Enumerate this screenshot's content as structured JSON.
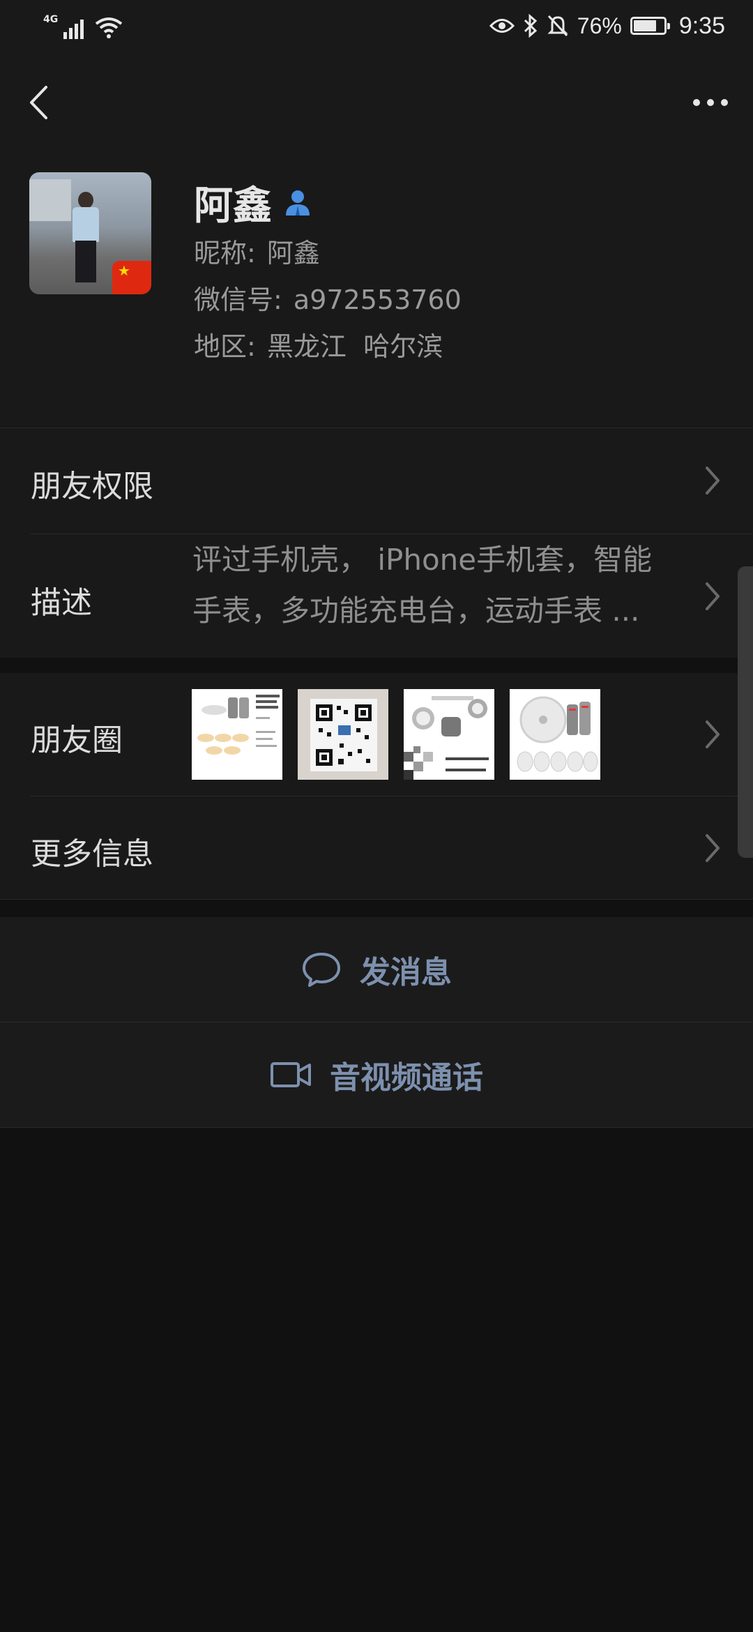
{
  "status_bar": {
    "network": "4G",
    "battery_percent": "76%",
    "time": "9:35",
    "icons": [
      "signal-icon",
      "wifi-icon",
      "eye-icon",
      "bluetooth-icon",
      "bell-off-icon",
      "battery-icon"
    ]
  },
  "header": {
    "back_icon": "chevron-left-icon",
    "more_icon": "more-horizontal-icon"
  },
  "profile": {
    "name": "阿鑫",
    "nickname_label": "昵称:",
    "nickname": "阿鑫",
    "wechat_id_label": "微信号:",
    "wechat_id": "a972553760",
    "region_label": "地区:",
    "region": "黑龙江  哈尔滨",
    "gender_icon": "person-icon"
  },
  "rows": {
    "friend_permissions": "朋友权限",
    "description_label": "描述",
    "description_line1": "评过手机壳， iPhone手机套，智能",
    "description_line2": "手表，多功能充电台，运动手表 ...",
    "moments_label": "朋友圈",
    "more_info": "更多信息"
  },
  "actions": {
    "send_message": "发消息",
    "video_call": "音视频通话"
  },
  "colors": {
    "background": "#111111",
    "panel": "#191919",
    "action_text": "#7d90ae",
    "gender_icon": "#4a90e2"
  }
}
